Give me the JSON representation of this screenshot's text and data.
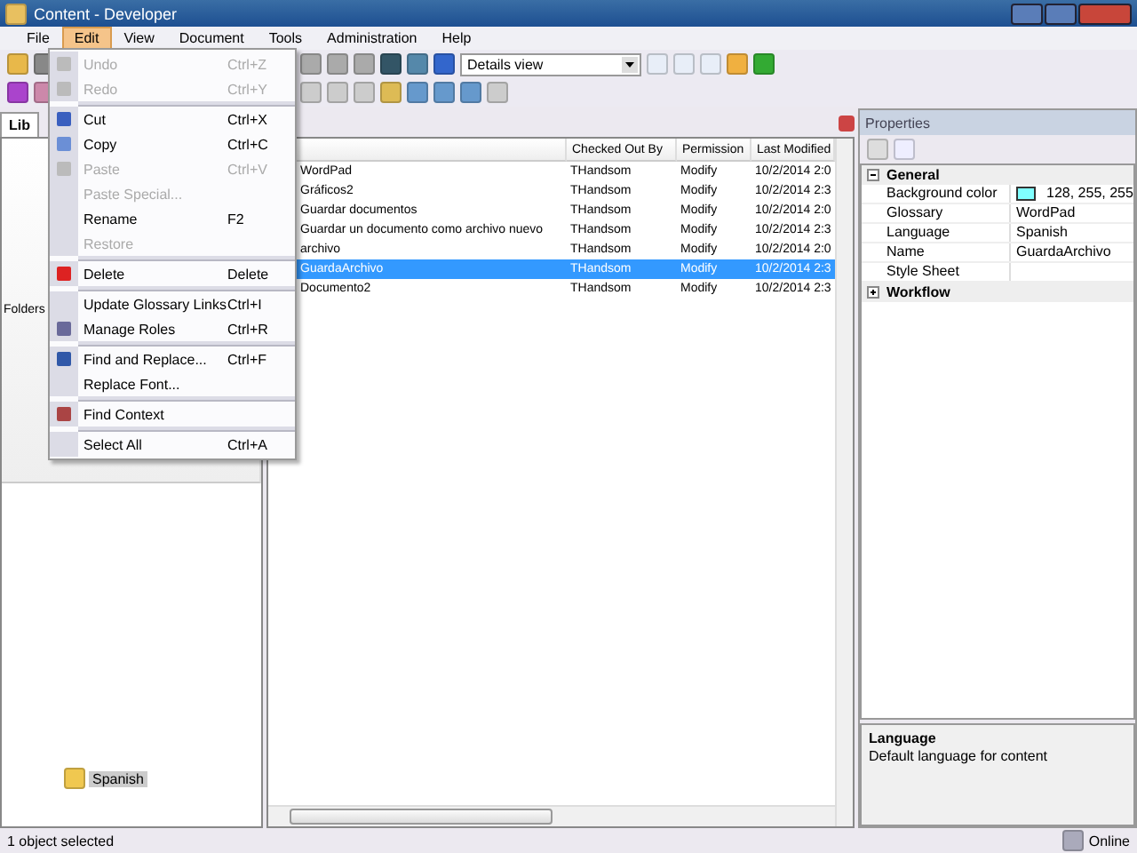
{
  "window": {
    "title": "Content - Developer"
  },
  "menu_bar": [
    {
      "label": "File",
      "selected": false
    },
    {
      "label": "Edit",
      "selected": true
    },
    {
      "label": "View",
      "selected": false
    },
    {
      "label": "Document",
      "selected": false
    },
    {
      "label": "Tools",
      "selected": false
    },
    {
      "label": "Administration",
      "selected": false
    },
    {
      "label": "Help",
      "selected": false
    }
  ],
  "edit_menu": [
    {
      "kind": "item",
      "label": "Undo",
      "shortcut": "Ctrl+Z",
      "disabled": true
    },
    {
      "kind": "item",
      "label": "Redo",
      "shortcut": "Ctrl+Y",
      "disabled": true
    },
    {
      "kind": "separator"
    },
    {
      "kind": "item",
      "label": "Cut",
      "shortcut": "Ctrl+X",
      "disabled": false
    },
    {
      "kind": "item",
      "label": "Copy",
      "shortcut": "Ctrl+C",
      "disabled": false
    },
    {
      "kind": "item",
      "label": "Paste",
      "shortcut": "Ctrl+V",
      "disabled": true
    },
    {
      "kind": "item",
      "label": "Paste Special...",
      "disabled": true
    },
    {
      "kind": "item",
      "label": "Rename",
      "shortcut": "F2",
      "disabled": false
    },
    {
      "kind": "item",
      "label": "Restore",
      "disabled": true
    },
    {
      "kind": "separator"
    },
    {
      "kind": "item",
      "label": "Delete",
      "shortcut": "Delete",
      "disabled": false
    },
    {
      "kind": "separator"
    },
    {
      "kind": "item",
      "label": "Update Glossary Links",
      "shortcut": "Ctrl+I",
      "disabled": false
    },
    {
      "kind": "item",
      "label": "Manage Roles",
      "shortcut": "Ctrl+R",
      "disabled": false
    },
    {
      "kind": "separator"
    },
    {
      "kind": "item",
      "label": "Find and Replace...",
      "shortcut": "Ctrl+F",
      "disabled": false
    },
    {
      "kind": "item",
      "label": "Replace Font...",
      "disabled": false
    },
    {
      "kind": "separator"
    },
    {
      "kind": "item",
      "label": "Find Context",
      "disabled": false
    },
    {
      "kind": "separator"
    },
    {
      "kind": "item",
      "label": "Select All",
      "shortcut": "Ctrl+A",
      "disabled": false
    }
  ],
  "toolbar": {
    "view_select": "Details view"
  },
  "left_panel": {
    "tab": "Lib",
    "header": "Folders",
    "selected_folder": "Spanish"
  },
  "table": {
    "columns": [
      "Checked Out By",
      "Permission",
      "Last Modified"
    ],
    "rows": [
      {
        "name": "WordPad",
        "checked_out_by": "THandsom",
        "permission": "Modify",
        "modified": "10/2/2014 2:0",
        "selected": false
      },
      {
        "name": "Gráficos2",
        "checked_out_by": "THandsom",
        "permission": "Modify",
        "modified": "10/2/2014 2:3",
        "selected": false
      },
      {
        "name": "Guardar documentos",
        "checked_out_by": "THandsom",
        "permission": "Modify",
        "modified": "10/2/2014 2:0",
        "selected": false
      },
      {
        "name": "Guardar un documento como archivo nuevo",
        "checked_out_by": "THandsom",
        "permission": "Modify",
        "modified": "10/2/2014 2:3",
        "selected": false
      },
      {
        "name": "archivo",
        "checked_out_by": "THandsom",
        "permission": "Modify",
        "modified": "10/2/2014 2:0",
        "selected": false
      },
      {
        "name": "GuardaArchivo",
        "checked_out_by": "THandsom",
        "permission": "Modify",
        "modified": "10/2/2014 2:3",
        "selected": true
      },
      {
        "name": "Documento2",
        "checked_out_by": "THandsom",
        "permission": "Modify",
        "modified": "10/2/2014 2:3",
        "selected": false
      }
    ]
  },
  "properties": {
    "title": "Properties",
    "groups": [
      {
        "name": "General",
        "expanded": true,
        "items": [
          {
            "name": "Background color",
            "value": "128, 255, 255",
            "color": "#80ffff"
          },
          {
            "name": "Glossary",
            "value": "WordPad"
          },
          {
            "name": "Language",
            "value": "Spanish"
          },
          {
            "name": "Name",
            "value": "GuardaArchivo"
          },
          {
            "name": "Style Sheet"
          }
        ]
      },
      {
        "name": "Workflow",
        "expanded": false
      }
    ],
    "description": {
      "title": "Language",
      "text": "Default language for content"
    }
  },
  "status_bar": {
    "message": "1 object selected",
    "connection": "Online"
  }
}
